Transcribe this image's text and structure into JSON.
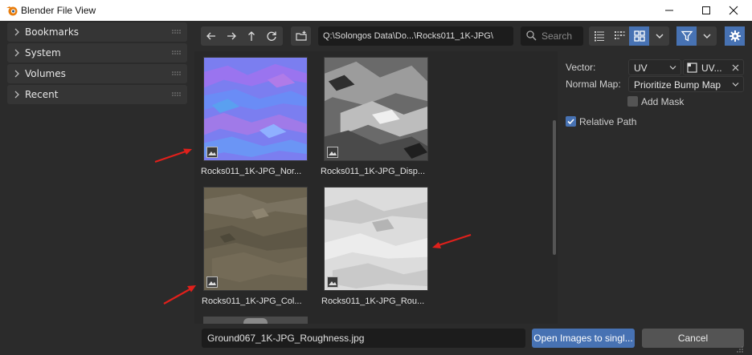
{
  "window": {
    "title": "Blender File View"
  },
  "sidebar": {
    "items": [
      {
        "label": "Bookmarks"
      },
      {
        "label": "System"
      },
      {
        "label": "Volumes"
      },
      {
        "label": "Recent"
      }
    ]
  },
  "toolbar": {
    "path": "Q:\\Solongos Data\\Do...\\Rocks011_1K-JPG\\",
    "search_placeholder": "Search"
  },
  "files": [
    {
      "name": "Rocks011_1K-JPG_Nor...",
      "texture": "normal"
    },
    {
      "name": "Rocks011_1K-JPG_Disp...",
      "texture": "displacement"
    },
    {
      "name": "Rocks011_1K-JPG_Col...",
      "texture": "color"
    },
    {
      "name": "Rocks011_1K-JPG_Rou...",
      "texture": "roughness"
    }
  ],
  "properties": {
    "vector_label": "Vector:",
    "vector_value": "UV",
    "uv_map_value": "UV...",
    "normal_map_label": "Normal Map:",
    "normal_map_value": "Prioritize Bump Map",
    "add_mask_label": "Add Mask",
    "add_mask_checked": false,
    "relative_path_label": "Relative Path",
    "relative_path_checked": true
  },
  "footer": {
    "filename": "Ground067_1K-JPG_Roughness.jpg",
    "open_button": "Open Images to singl...",
    "cancel_button": "Cancel"
  },
  "colors": {
    "accent": "#4772b3",
    "annotation_arrow": "#e0201b"
  },
  "icons": [
    "blender-logo-icon",
    "minimize-icon",
    "maximize-icon",
    "close-icon",
    "back-icon",
    "forward-icon",
    "parent-directory-icon",
    "refresh-icon",
    "new-folder-icon",
    "search-icon",
    "vertical-list-icon",
    "horizontal-list-icon",
    "thumbnails-icon",
    "filter-icon",
    "settings-icon"
  ]
}
